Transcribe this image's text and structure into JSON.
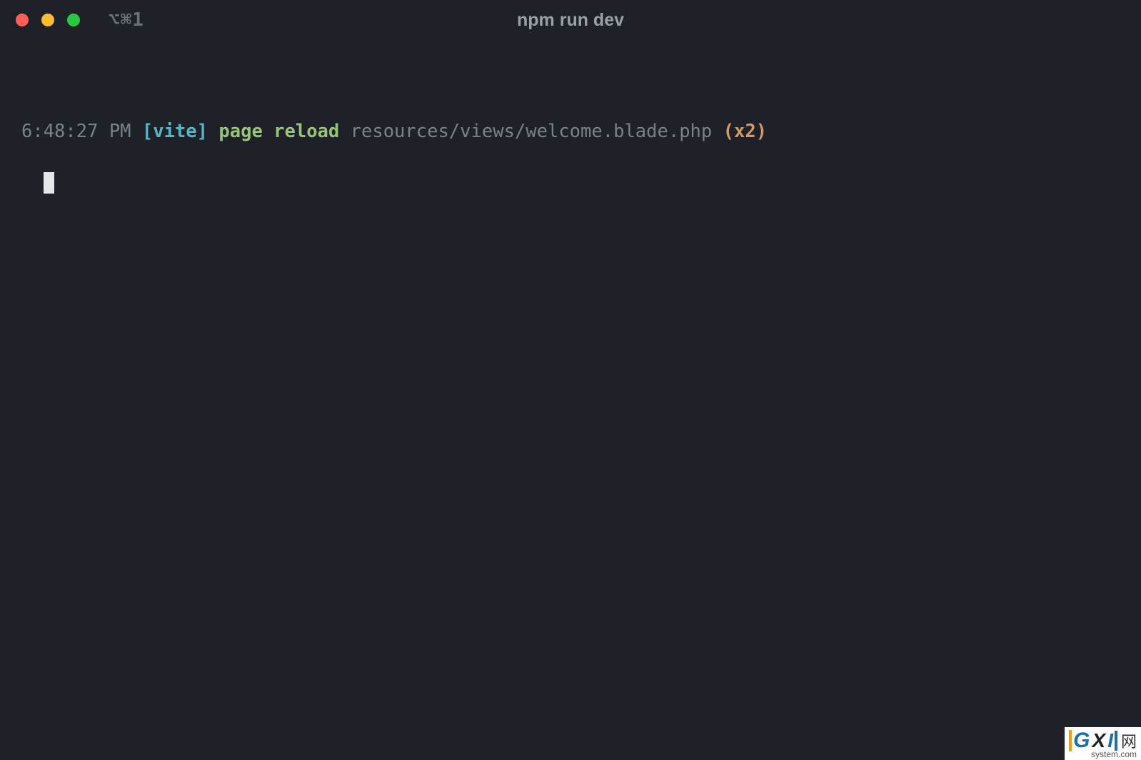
{
  "titlebar": {
    "shortcut": "⌥⌘1",
    "title": "npm run dev"
  },
  "log": {
    "timestamp": "6:48:27 PM",
    "tag_open": "[",
    "tag_name": "vite",
    "tag_close": "]",
    "message": "page reload",
    "path": "resources/views/welcome.blade.php",
    "count": "(x2)"
  },
  "watermark": {
    "g": "G",
    "x": "X",
    "i": "I",
    "cn": "网",
    "sub": "system.com"
  }
}
